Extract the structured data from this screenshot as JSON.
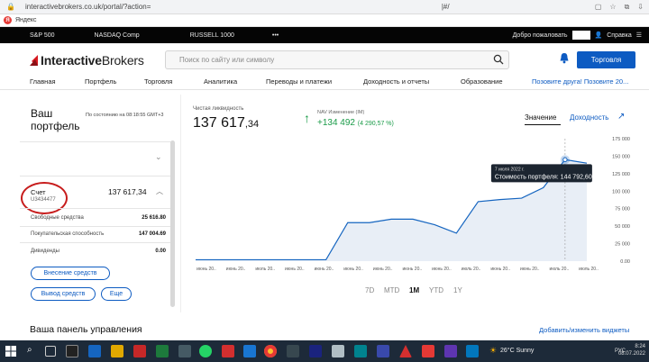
{
  "browser": {
    "url_text": "interactivebrokers.co.uk/portal/?action=",
    "url_tail": "|#/",
    "bookmark": "Яндекс"
  },
  "ticker": {
    "items": [
      "S&P 500",
      "NASDAQ Comp",
      "RUSSELL 1000",
      "•••"
    ],
    "greeting": "Добро пожаловать",
    "help": "Справка"
  },
  "header": {
    "logo_bold": "Interactive",
    "logo_light": "Brokers",
    "search_placeholder": "Поиск по сайту или символу",
    "trade_button": "Торговля"
  },
  "nav": {
    "items": [
      "Главная",
      "Портфель",
      "Торговля",
      "Аналитика",
      "Переводы и платежи",
      "Доходность и отчеты",
      "Образование"
    ],
    "invite": "Позовите друга! Позовите 20..."
  },
  "portfolio": {
    "title_line1": "Ваш",
    "title_line2": "портфель",
    "as_of": "По состоянию на 08:18:55 GMT+3",
    "account_label": "Счет",
    "account_id": "U3434477",
    "account_value": "137 617,34",
    "rows": [
      {
        "label": "Свободные средства",
        "value": "25 616.80"
      },
      {
        "label": "Покупательская способность",
        "value": "147 004.69"
      },
      {
        "label": "Дивиденды",
        "value": "0.00"
      }
    ],
    "deposit_button": "Внесение средств",
    "withdraw_button": "Вывод средств",
    "more_button": "Еще"
  },
  "summary": {
    "nl_label": "Чистая ликвидность",
    "nl_main": "137 617",
    "nl_cents": ",34",
    "nav_label": "NAV Изменение (IM)",
    "nav_value": "+134 492",
    "nav_pct": "(4 290,57 %)",
    "tab_value": "Значение",
    "tab_yield": "Доходность"
  },
  "chart_data": {
    "type": "line",
    "x": [
      "июнь 20..",
      "июнь 20..",
      "июль 20..",
      "июнь 20..",
      "июнь 20..",
      "июнь 20..",
      "июнь 20..",
      "июнь 20..",
      "июнь 20..",
      "июль 20..",
      "июнь 20..",
      "июнь 20..",
      "июль 20..",
      "июль 20.."
    ],
    "values": [
      2000,
      2000,
      2000,
      2000,
      2000,
      2000,
      2000,
      55000,
      55000,
      60000,
      60000,
      52000,
      40000,
      85000,
      88000,
      90000,
      105000,
      145000,
      140000
    ],
    "yticks": [
      "175 000",
      "150 000",
      "125 000",
      "100 000",
      "75 000",
      "50 000",
      "25 000",
      "0.00"
    ],
    "ylim": [
      0,
      175000
    ],
    "tooltip_date": "7 июля 2022 г.",
    "tooltip_label": "Стоимость портфеля:",
    "tooltip_value": "144 792,60",
    "color": "#1565c0"
  },
  "ranges": [
    "7D",
    "MTD",
    "1M",
    "YTD",
    "1Y"
  ],
  "active_range": "1M",
  "dashboard": {
    "title": "Ваша панель управления",
    "edit_link": "Добавить/изменить виджеты"
  },
  "taskbar": {
    "weather": "26°C  Sunny",
    "time": "8:24",
    "date": "08.07.2022",
    "lang": "РУС"
  }
}
